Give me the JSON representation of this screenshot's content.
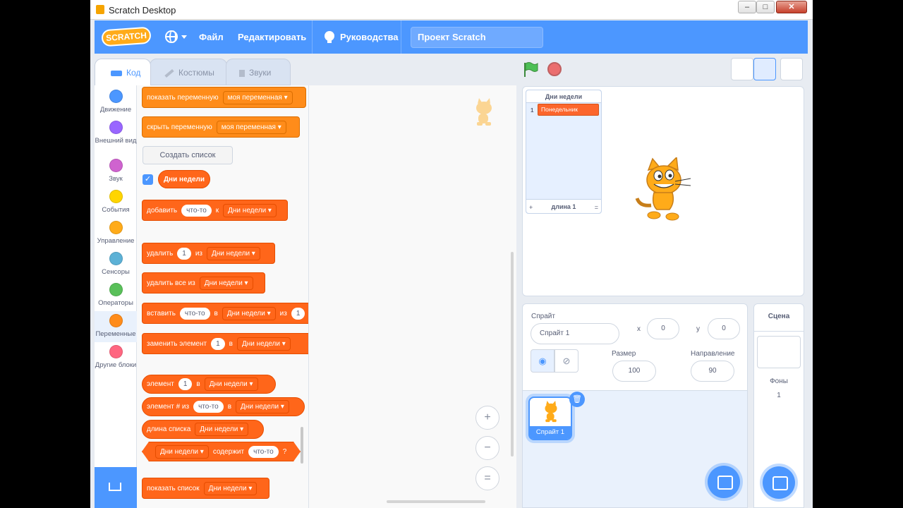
{
  "window": {
    "title": "Scratch Desktop",
    "controls": [
      "–",
      "□",
      "✕"
    ]
  },
  "menubar": {
    "logo": "SCRATCH",
    "file": "Файл",
    "edit": "Редактировать",
    "tutorials": "Руководства",
    "project_title": "Проект Scratch"
  },
  "tabs": {
    "code": "Код",
    "costumes": "Костюмы",
    "sounds": "Звуки"
  },
  "categories": [
    {
      "label": "Движение",
      "color": "#4c97ff"
    },
    {
      "label": "Внешний вид",
      "color": "#9966ff"
    },
    {
      "label": "Звук",
      "color": "#cf63cf"
    },
    {
      "label": "События",
      "color": "#ffd500"
    },
    {
      "label": "Управление",
      "color": "#ffab19"
    },
    {
      "label": "Сенсоры",
      "color": "#5cb1d6"
    },
    {
      "label": "Операторы",
      "color": "#59c059"
    },
    {
      "label": "Переменные",
      "color": "#ff8c1a"
    },
    {
      "label": "Другие блоки",
      "color": "#ff6680"
    }
  ],
  "palette": {
    "show_variable": {
      "text": "показать переменную",
      "var": "моя переменная"
    },
    "hide_variable": {
      "text": "скрыть переменную",
      "var": "моя переменная"
    },
    "make_list": "Создать список",
    "list_reporter": "Дни недели",
    "add": {
      "a": "добавить",
      "val": "что-то",
      "b": "к",
      "list": "Дни недели"
    },
    "delete": {
      "a": "удалить",
      "val": "1",
      "b": "из",
      "list": "Дни недели"
    },
    "delete_all": {
      "a": "удалить все из",
      "list": "Дни недели"
    },
    "insert": {
      "a": "вставить",
      "val": "что-то",
      "b": "в",
      "list": "Дни недели",
      "c": "из",
      "val2": "1"
    },
    "replace": {
      "a": "заменить элемент",
      "val": "1",
      "b": "в",
      "list": "Дни недели"
    },
    "item": {
      "a": "элемент",
      "val": "1",
      "b": "в",
      "list": "Дни недели"
    },
    "item_num": {
      "a": "элемент # из",
      "val": "что-то",
      "b": "в",
      "list": "Дни недели"
    },
    "length": {
      "a": "длина списка",
      "list": "Дни недели"
    },
    "contains": {
      "list": "Дни недели",
      "a": "содержит",
      "val": "что-то",
      "q": "?"
    },
    "show_list": {
      "a": "показать список",
      "list": "Дни недели"
    }
  },
  "zoom": {
    "in": "+",
    "out": "−",
    "reset": "="
  },
  "stage": {
    "list_monitor": {
      "title": "Дни недели",
      "items": [
        {
          "index": "1",
          "value": "Понедельник"
        }
      ],
      "add": "+",
      "length_label": "длина 1",
      "resize": "="
    }
  },
  "sprite_info": {
    "sprite_label": "Спрайт",
    "sprite_name": "Спрайт 1",
    "x_label": "x",
    "x": "0",
    "y_label": "y",
    "y": "0",
    "size_label": "Размер",
    "size": "100",
    "direction_label": "Направление",
    "direction": "90"
  },
  "sprites": [
    {
      "name": "Спрайт 1"
    }
  ],
  "scene": {
    "title": "Сцена",
    "backdrops_label": "Фоны",
    "backdrops_count": "1"
  }
}
